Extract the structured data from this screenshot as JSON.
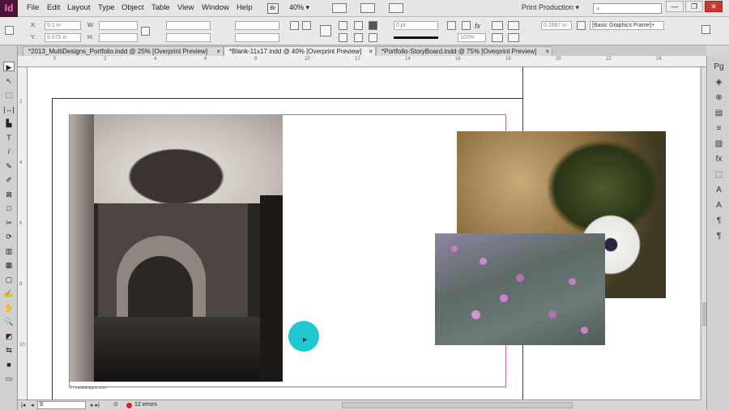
{
  "app": {
    "logo": "Id",
    "menus": [
      "File",
      "Edit",
      "Layout",
      "Type",
      "Object",
      "Table",
      "View",
      "Window",
      "Help"
    ],
    "bridge": "Br",
    "zoom": "40%",
    "workspace": "Print Production",
    "search_placeholder": "",
    "window_buttons": [
      "—",
      "❐",
      "✕"
    ]
  },
  "control": {
    "x_label": "X:",
    "x_value": "9.1 in",
    "y_label": "Y:",
    "y_value": "8.675 in",
    "w_label": "W:",
    "h_label": "H:",
    "stroke_weight": "0 pt",
    "opacity": "100%",
    "ref_value": "0.1667 in",
    "frame_style": "[Basic Graphics Frame]+",
    "fx": "fx"
  },
  "tabs": [
    {
      "label": "*2013_MultiDesigns_Portfolio.indd @ 25% [Overprint Preview]",
      "active": false
    },
    {
      "label": "*Blank-11x17.indd @ 40% [Overprint Preview]",
      "active": true
    },
    {
      "label": "*Portfolio-StoryBoard.indd @ 75% [Overprint Preview]",
      "active": false
    }
  ],
  "tab_close": "×",
  "tools": [
    "▶",
    "↖",
    "⬚",
    "|↔|",
    "▙",
    "T",
    "/",
    "✎",
    "✐",
    "⊠",
    "□",
    "✂",
    "⟳",
    "▥",
    "▦",
    "▢",
    "✍",
    "✋",
    "🔍",
    "◩",
    "⇆",
    "■",
    "▭"
  ],
  "right_panel": [
    "Pg",
    "◈",
    "⊗",
    "▤",
    "≡",
    "▧",
    "fx",
    "⬚",
    "A",
    "A",
    "¶",
    "¶"
  ],
  "ruler_marks": [
    "0",
    "2",
    "4",
    "6",
    "8",
    "10",
    "12",
    "14",
    "16",
    "18",
    "20",
    "22",
    "24"
  ],
  "ruler_v_marks": [
    "2",
    "4",
    "6",
    "8",
    "10"
  ],
  "status": {
    "page": "9",
    "preflight": "12 errors"
  },
  "credit_line": "J | multidesigns.com",
  "colors": {
    "accent": "#c064d0",
    "cursor": "#1ec8d1",
    "logo_bg": "#4a1635"
  }
}
